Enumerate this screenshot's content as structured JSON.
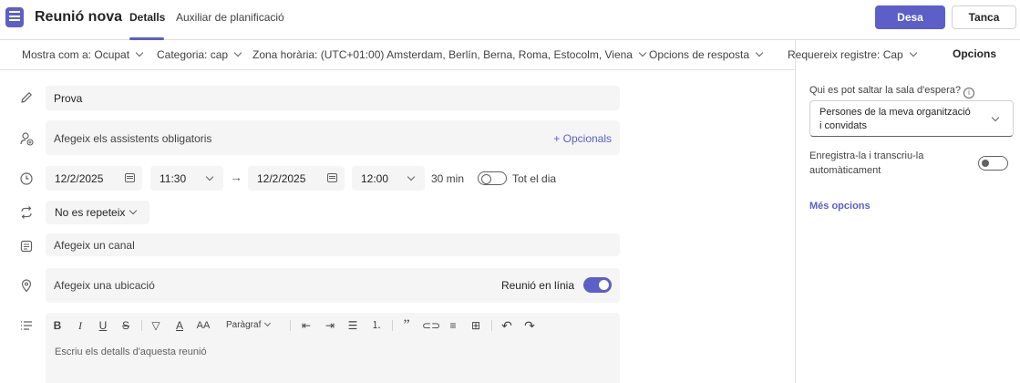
{
  "header": {
    "title": "Reunió nova",
    "tabs": [
      {
        "label": "Detalls",
        "active": true
      },
      {
        "label": "Auxiliar de planificació",
        "active": false
      }
    ],
    "send_label": "Desa",
    "close_label": "Tanca"
  },
  "options_bar": {
    "show_as": "Mostra com a: Ocupat",
    "category": "Categoria: cap",
    "timezone": "Zona horària: (UTC+01:00) Amsterdam, Berlín, Berna, Roma, Estocolm, Viena",
    "response": "Opcions de resposta",
    "registration": "Requereix registre: Cap"
  },
  "panel": {
    "title": "Opcions",
    "lobby_label": "Qui es pot saltar la sala d'espera?",
    "lobby_value_line1": "Persones de la meva organització",
    "lobby_value_line2": "i convidats",
    "record_label": "Enregistra-la i transcriu-la automàticament",
    "record_on": false,
    "more_options": "Més opcions"
  },
  "form": {
    "title_value": "Prova",
    "attendees_placeholder": "Afegeix els assistents obligatoris",
    "optional_link": "+ Opcionals",
    "start_date": "12/2/2025",
    "start_time": "11:30",
    "end_date": "12/2/2025",
    "end_time": "12:00",
    "duration": "30 min",
    "all_day_label": "Tot el dia",
    "all_day_on": false,
    "repeat": "No es repeteix",
    "channel_placeholder": "Afegeix un canal",
    "location_placeholder": "Afegeix una ubicació",
    "online_label": "Reunió en línia",
    "online_on": true
  },
  "editor": {
    "paragraph_label": "Paràgraf",
    "placeholder": "Escriu els detalls d'aquesta reunió"
  },
  "colors": {
    "accent": "#5b5fc7",
    "field_bg": "#f5f5f5",
    "border": "#e0e0e0"
  }
}
